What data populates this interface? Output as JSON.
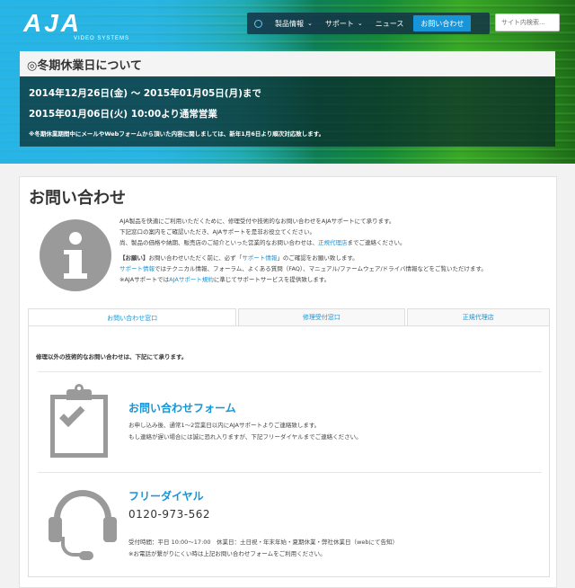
{
  "brand": {
    "logo": "AJA",
    "logo_sub": "VIDEO SYSTEMS"
  },
  "nav": {
    "items": [
      {
        "label": "製品情報",
        "has_dropdown": true
      },
      {
        "label": "サポート",
        "has_dropdown": true
      },
      {
        "label": "ニュース",
        "has_dropdown": false
      }
    ],
    "contact_label": "お問い合わせ",
    "dropdown_glyph": "⌄"
  },
  "search": {
    "placeholder": "サイト内検索..."
  },
  "notice": {
    "title": "◎冬期休業日について",
    "line1": "2014年12月26日(金) ～ 2015年01月05日(月)まで",
    "line2": "2015年01月06日(火) 10:00より通常営業",
    "note": "※冬期休業期間中にメールやWebフォームから頂いた内容に関しましては、新年1月6日より順次対応致します。"
  },
  "page": {
    "title": "お問い合わせ",
    "intro": {
      "p1_l1": "AJA製品を快適にご利用いただくために、修理受付や技術的なお問い合わせをAJAサポートにて承ります。",
      "p1_l2": "下記窓口の案内をご確認いただき、AJAサポートを是非お役立てください。",
      "p1_l3_a": "尚、製品の価格や納期、販売店のご紹介といった営業的なお問い合わせは、",
      "p1_l3_link": "正規代理店",
      "p1_l3_b": "までご連絡ください。",
      "p2_l1_a": "【お願い】",
      "p2_l1_b": "お問い合わせいただく前に、必ず「",
      "p2_l1_link": "サポート情報",
      "p2_l1_c": "」のご確認をお願い致します。",
      "p2_l2_link": "サポート情報",
      "p2_l2_b": "ではテクニカル情報、フォーラム、よくある質問（FAQ）、マニュアル/ファームウェア/ドライバ情報などをご覧いただけます。",
      "p2_l3_a": "※AJAサポートでは",
      "p2_l3_link": "AJAサポート規約",
      "p2_l3_b": "に準じてサポートサービスを提供致します。"
    }
  },
  "tabs": [
    {
      "label": "お問い合わせ窓口",
      "active": true
    },
    {
      "label": "修理受付窓口",
      "active": false
    },
    {
      "label": "正規代理店",
      "active": false
    }
  ],
  "panel": {
    "lead": "修理以外の技術的なお問い合わせは、下記にて承ります。",
    "form": {
      "title": "お問い合わせフォーム",
      "l1": "お申し込み後、通常1～2営業日以内にAJAサポートよりご連絡致します。",
      "l2": "もし連絡が遅い場合には誠に恐れ入りますが、下記フリーダイヤルまでご連絡ください。"
    },
    "dial": {
      "title": "フリーダイヤル",
      "number": "0120-973-562",
      "hours": "受付時間：平日 10:00～17:00　休業日：土日祝・年末年始・夏期休業・弊社休業日（webにて告知）",
      "note": "※お電話が繋がりにくい時は上記お問い合わせフォームをご利用ください。"
    }
  },
  "colors": {
    "accent": "#1795d8",
    "icon_gray": "#9a9a9a"
  }
}
